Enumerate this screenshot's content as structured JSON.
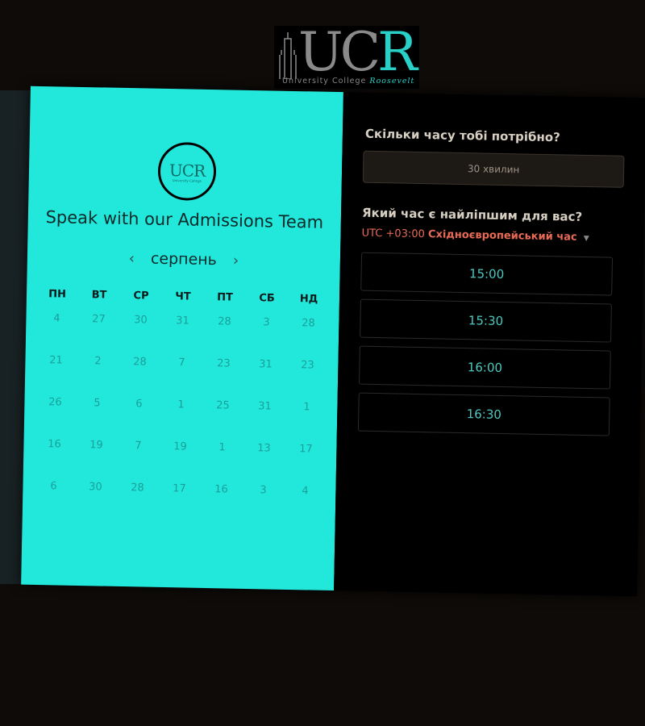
{
  "header": {
    "logo_text": "UCR",
    "logo_tagline": "University College",
    "logo_tagline_accent": "Roosevelt"
  },
  "left": {
    "round_logo_text": "UCR",
    "title": "Speak with our Admissions Team",
    "month": "серпень",
    "prev_icon": "‹",
    "next_icon": "›",
    "weekdays": [
      "ПН",
      "ВТ",
      "СР",
      "ЧТ",
      "ПТ",
      "СБ",
      "НД"
    ],
    "weeks": [
      [
        "4",
        "27",
        "30",
        "31",
        "28",
        "3",
        "28"
      ],
      [
        "21",
        "2",
        "28",
        "7",
        "23",
        "31",
        "23"
      ],
      [
        "26",
        "5",
        "6",
        "1",
        "25",
        "31",
        "1"
      ],
      [
        "16",
        "19",
        "7",
        "19",
        "1",
        "13",
        "17"
      ],
      [
        "6",
        "30",
        "28",
        "17",
        "16",
        "3",
        "4"
      ]
    ]
  },
  "right": {
    "duration_question": "Скільки часу тобі потрібно?",
    "duration_value": "30 хвилин",
    "time_question": "Який час є найліпшим для вас?",
    "tz_offset": "UTC +03:00",
    "tz_name": "Східноєвропейський час",
    "tz_caret": "▼",
    "slots": [
      "15:00",
      "15:30",
      "16:00",
      "16:30"
    ]
  },
  "colors": {
    "accent": "#22e8dc",
    "slot_text": "#4cc9c0",
    "timezone": "#e86a55"
  }
}
